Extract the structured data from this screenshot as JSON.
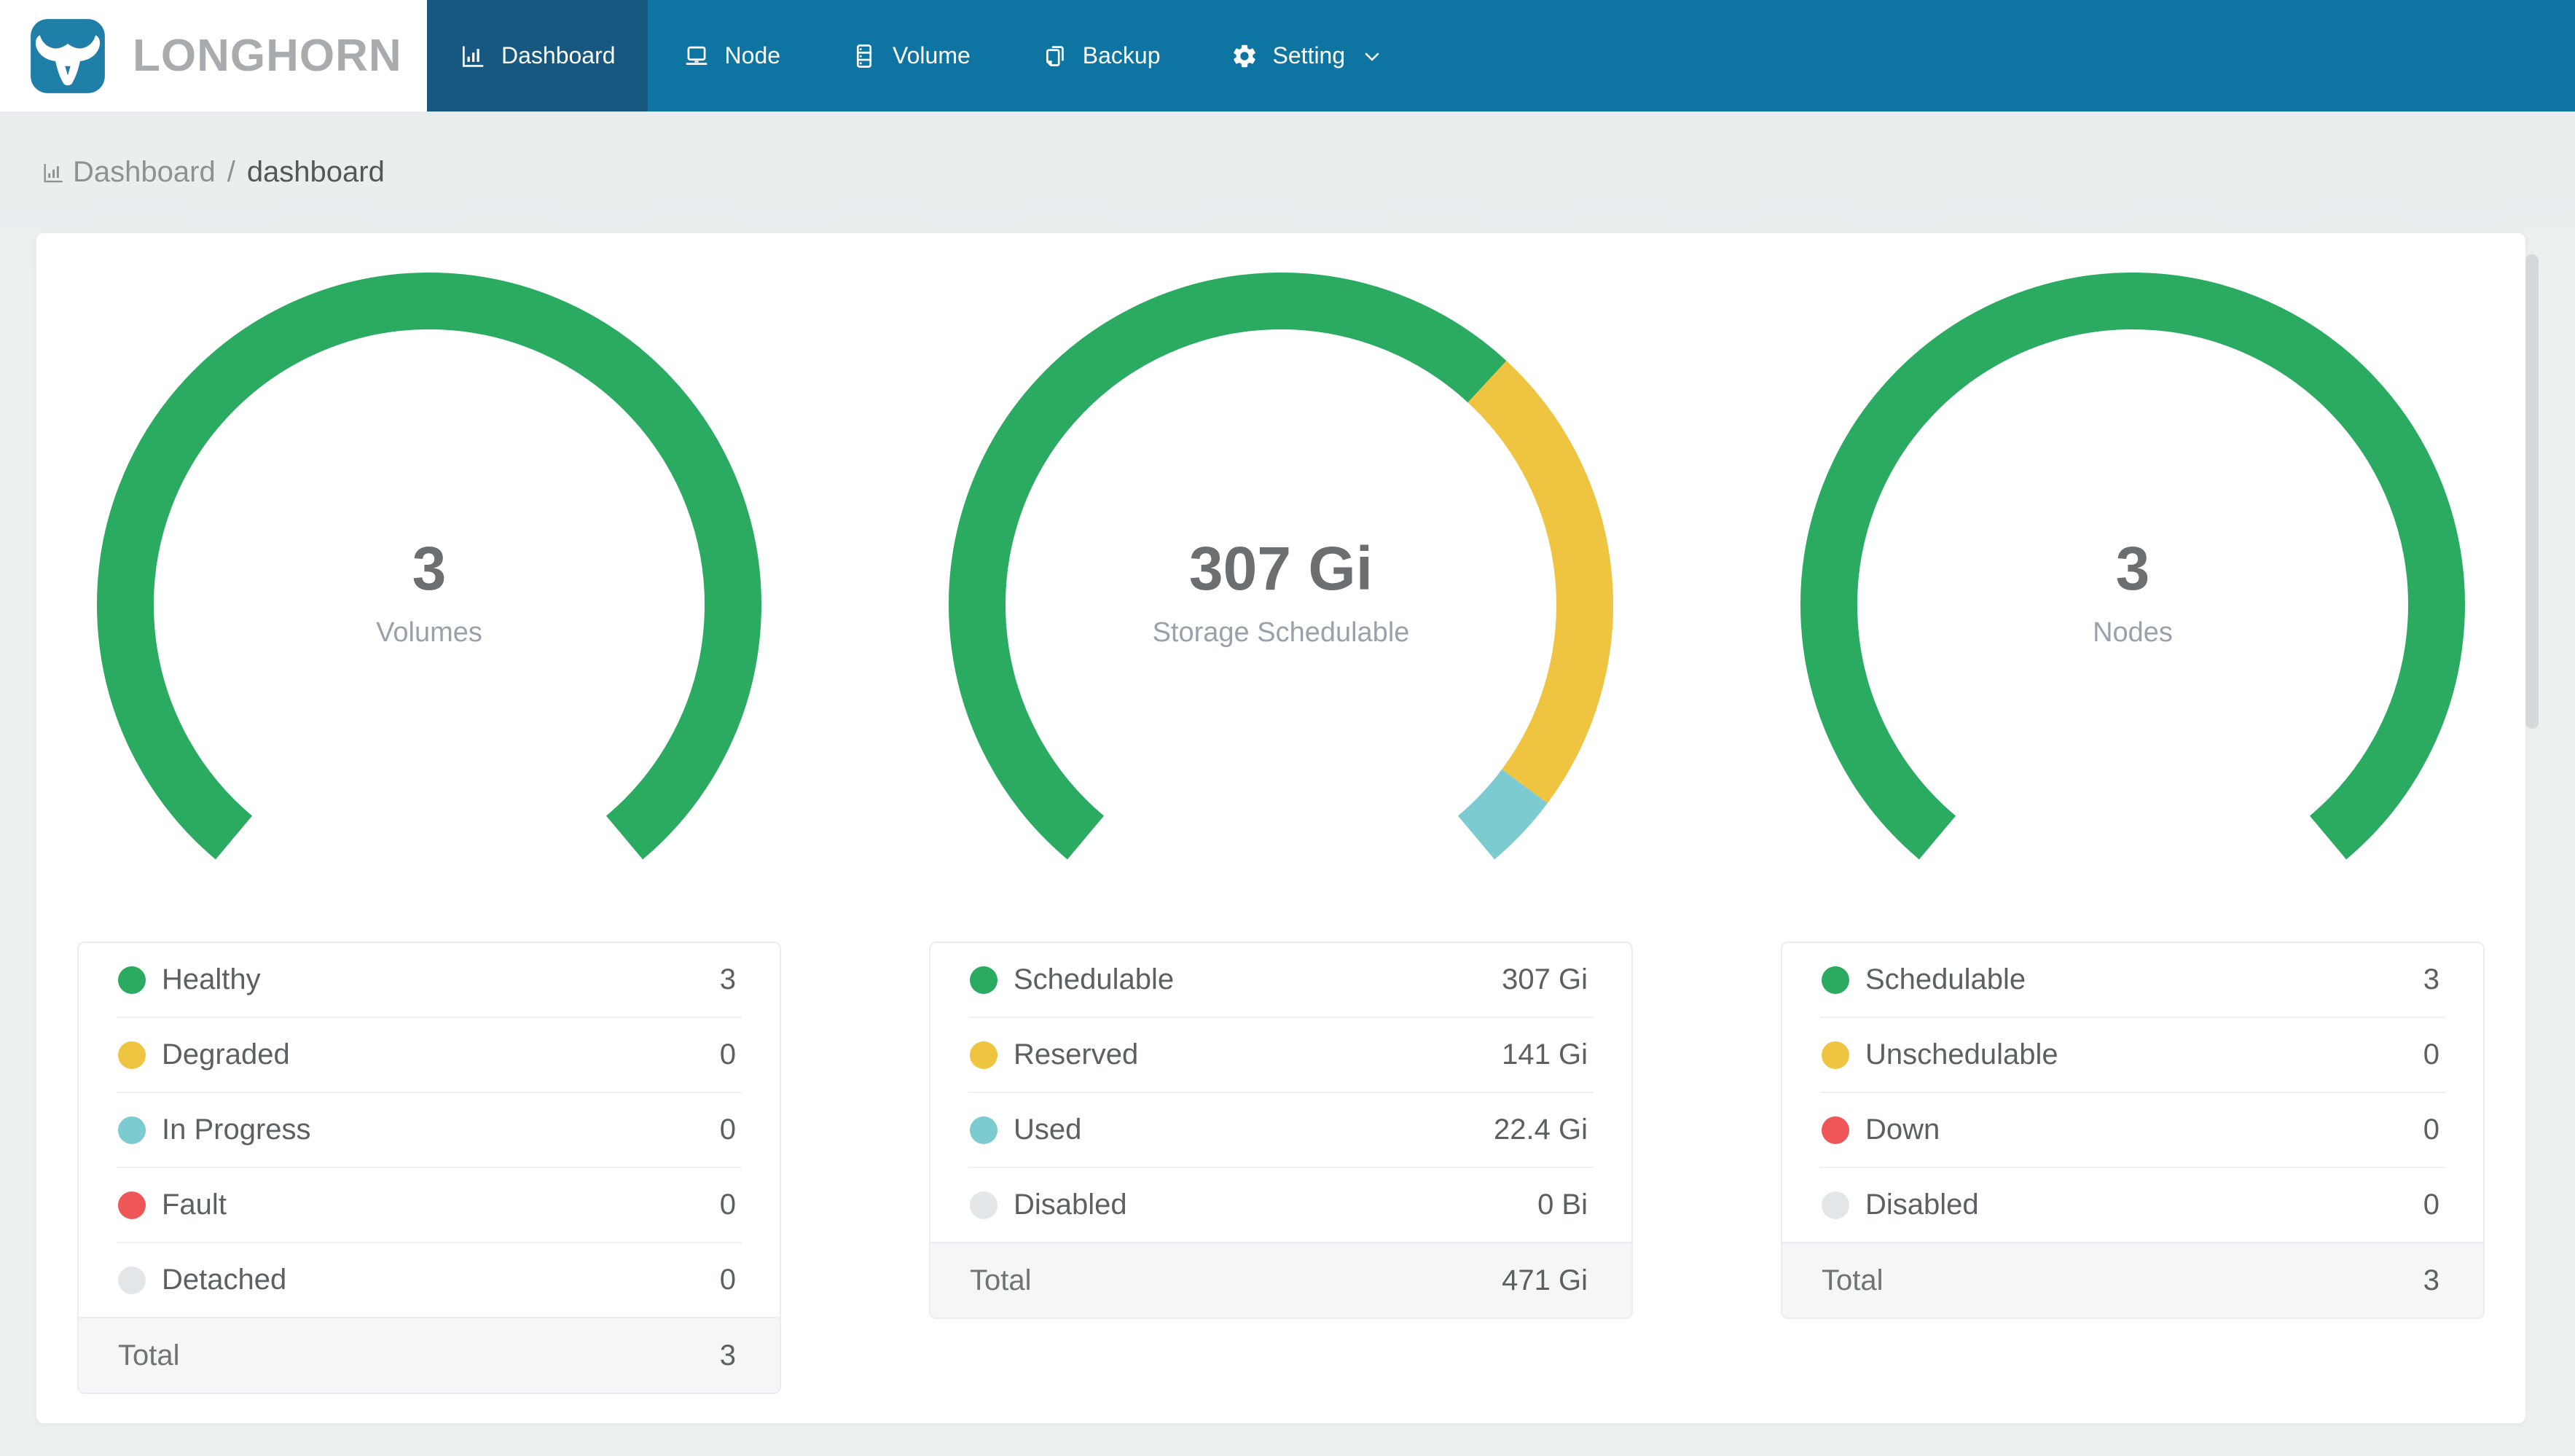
{
  "brand": {
    "name": "LONGHORN"
  },
  "theme": {
    "header_bg": "#0E75A3",
    "header_active_bg": "#16587F",
    "logo_blue": "#1F7FA8",
    "page_bg": "#ECF0F1"
  },
  "nav": {
    "items": [
      {
        "label": "Dashboard",
        "icon": "dashboard-icon",
        "active": true
      },
      {
        "label": "Node",
        "icon": "node-icon",
        "active": false
      },
      {
        "label": "Volume",
        "icon": "volume-icon",
        "active": false
      },
      {
        "label": "Backup",
        "icon": "backup-icon",
        "active": false
      },
      {
        "label": "Setting",
        "icon": "setting-icon",
        "active": false,
        "has_dropdown": true
      }
    ]
  },
  "breadcrumb": {
    "root": "Dashboard",
    "separator": "/",
    "current": "dashboard"
  },
  "charts": [
    {
      "center_value": "3",
      "center_label": "Volumes",
      "rows": [
        {
          "label": "Healthy",
          "display": "3",
          "num": 3,
          "color": "#2BAB61"
        },
        {
          "label": "Degraded",
          "display": "0",
          "num": 0,
          "color": "#EFC441"
        },
        {
          "label": "In Progress",
          "display": "0",
          "num": 0,
          "color": "#7BCBD1"
        },
        {
          "label": "Fault",
          "display": "0",
          "num": 0,
          "color": "#EF5657"
        },
        {
          "label": "Detached",
          "display": "0",
          "num": 0,
          "color": "#E3E6E8"
        }
      ],
      "total_label": "Total",
      "total_value": "3"
    },
    {
      "center_value": "307 Gi",
      "center_label": "Storage Schedulable",
      "rows": [
        {
          "label": "Schedulable",
          "display": "307 Gi",
          "num": 307,
          "color": "#2BAB61"
        },
        {
          "label": "Reserved",
          "display": "141 Gi",
          "num": 141,
          "color": "#EFC441"
        },
        {
          "label": "Used",
          "display": "22.4 Gi",
          "num": 22.4,
          "color": "#7BCBD1"
        },
        {
          "label": "Disabled",
          "display": "0 Bi",
          "num": 0,
          "color": "#E3E6E8"
        }
      ],
      "total_label": "Total",
      "total_value": "471 Gi"
    },
    {
      "center_value": "3",
      "center_label": "Nodes",
      "rows": [
        {
          "label": "Schedulable",
          "display": "3",
          "num": 3,
          "color": "#2BAB61"
        },
        {
          "label": "Unschedulable",
          "display": "0",
          "num": 0,
          "color": "#EFC441"
        },
        {
          "label": "Down",
          "display": "0",
          "num": 0,
          "color": "#EF5657"
        },
        {
          "label": "Disabled",
          "display": "0",
          "num": 0,
          "color": "#E3E6E8"
        }
      ],
      "total_label": "Total",
      "total_value": "3"
    }
  ]
}
